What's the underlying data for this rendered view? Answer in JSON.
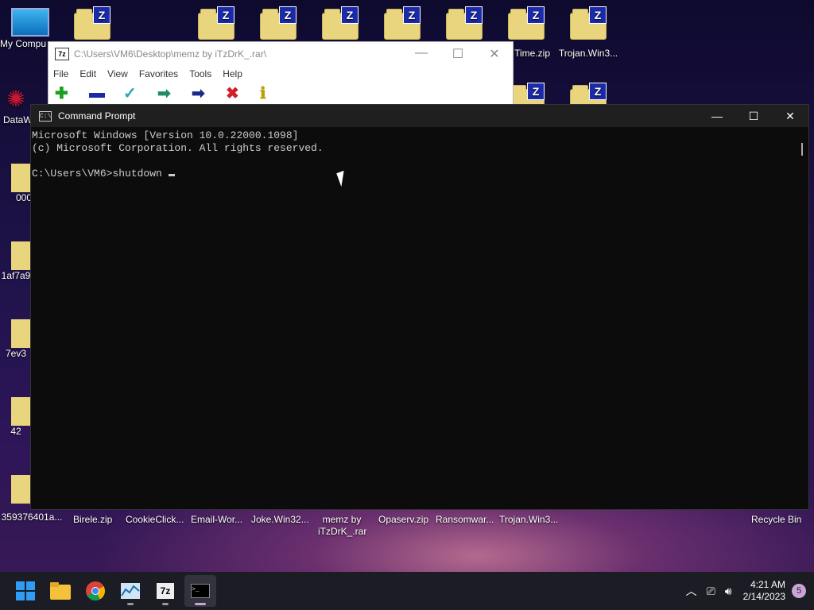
{
  "desktop": {
    "top_icons": [
      "My Compu",
      "",
      "",
      "",
      "",
      "",
      "",
      "",
      "Time.zip",
      "Trojan.Win3..."
    ],
    "left_icons": [
      "DataW",
      "000",
      "1af7a9",
      "7ev3",
      "42",
      "359376401a..."
    ],
    "bottom_icons": [
      "Birele.zip",
      "CookieClick...",
      "Email-Wor...",
      "Joke.Win32...",
      "memz by iTzDrK_.rar",
      "Opaserv.zip",
      "Ransomwar...",
      "Trojan.Win3...",
      "Recycle Bin"
    ]
  },
  "zip_window": {
    "title": "C:\\Users\\VM6\\Desktop\\memz by iTzDrK_.rar\\",
    "app_icon": "7z",
    "menu": [
      "File",
      "Edit",
      "View",
      "Favorites",
      "Tools",
      "Help"
    ],
    "toolbar": [
      {
        "name": "add",
        "glyph": "✚",
        "color": "#1aa01a"
      },
      {
        "name": "extract",
        "glyph": "▬",
        "color": "#1b2aa8"
      },
      {
        "name": "test",
        "glyph": "✓",
        "color": "#2aa4b4"
      },
      {
        "name": "copy",
        "glyph": "➡",
        "color": "#1f8a6a"
      },
      {
        "name": "move",
        "glyph": "➡",
        "color": "#1b2a88"
      },
      {
        "name": "delete",
        "glyph": "✖",
        "color": "#d0202a"
      },
      {
        "name": "info",
        "glyph": "ℹ",
        "color": "#b8a000"
      }
    ]
  },
  "cmd": {
    "title": "Command Prompt",
    "lines": [
      "Microsoft Windows [Version 10.0.22000.1098]",
      "(c) Microsoft Corporation. All rights reserved.",
      "",
      "C:\\Users\\VM6>shutdown "
    ]
  },
  "taskbar": {
    "time": "4:21 AM",
    "date": "2/14/2023",
    "notifications": "5"
  }
}
